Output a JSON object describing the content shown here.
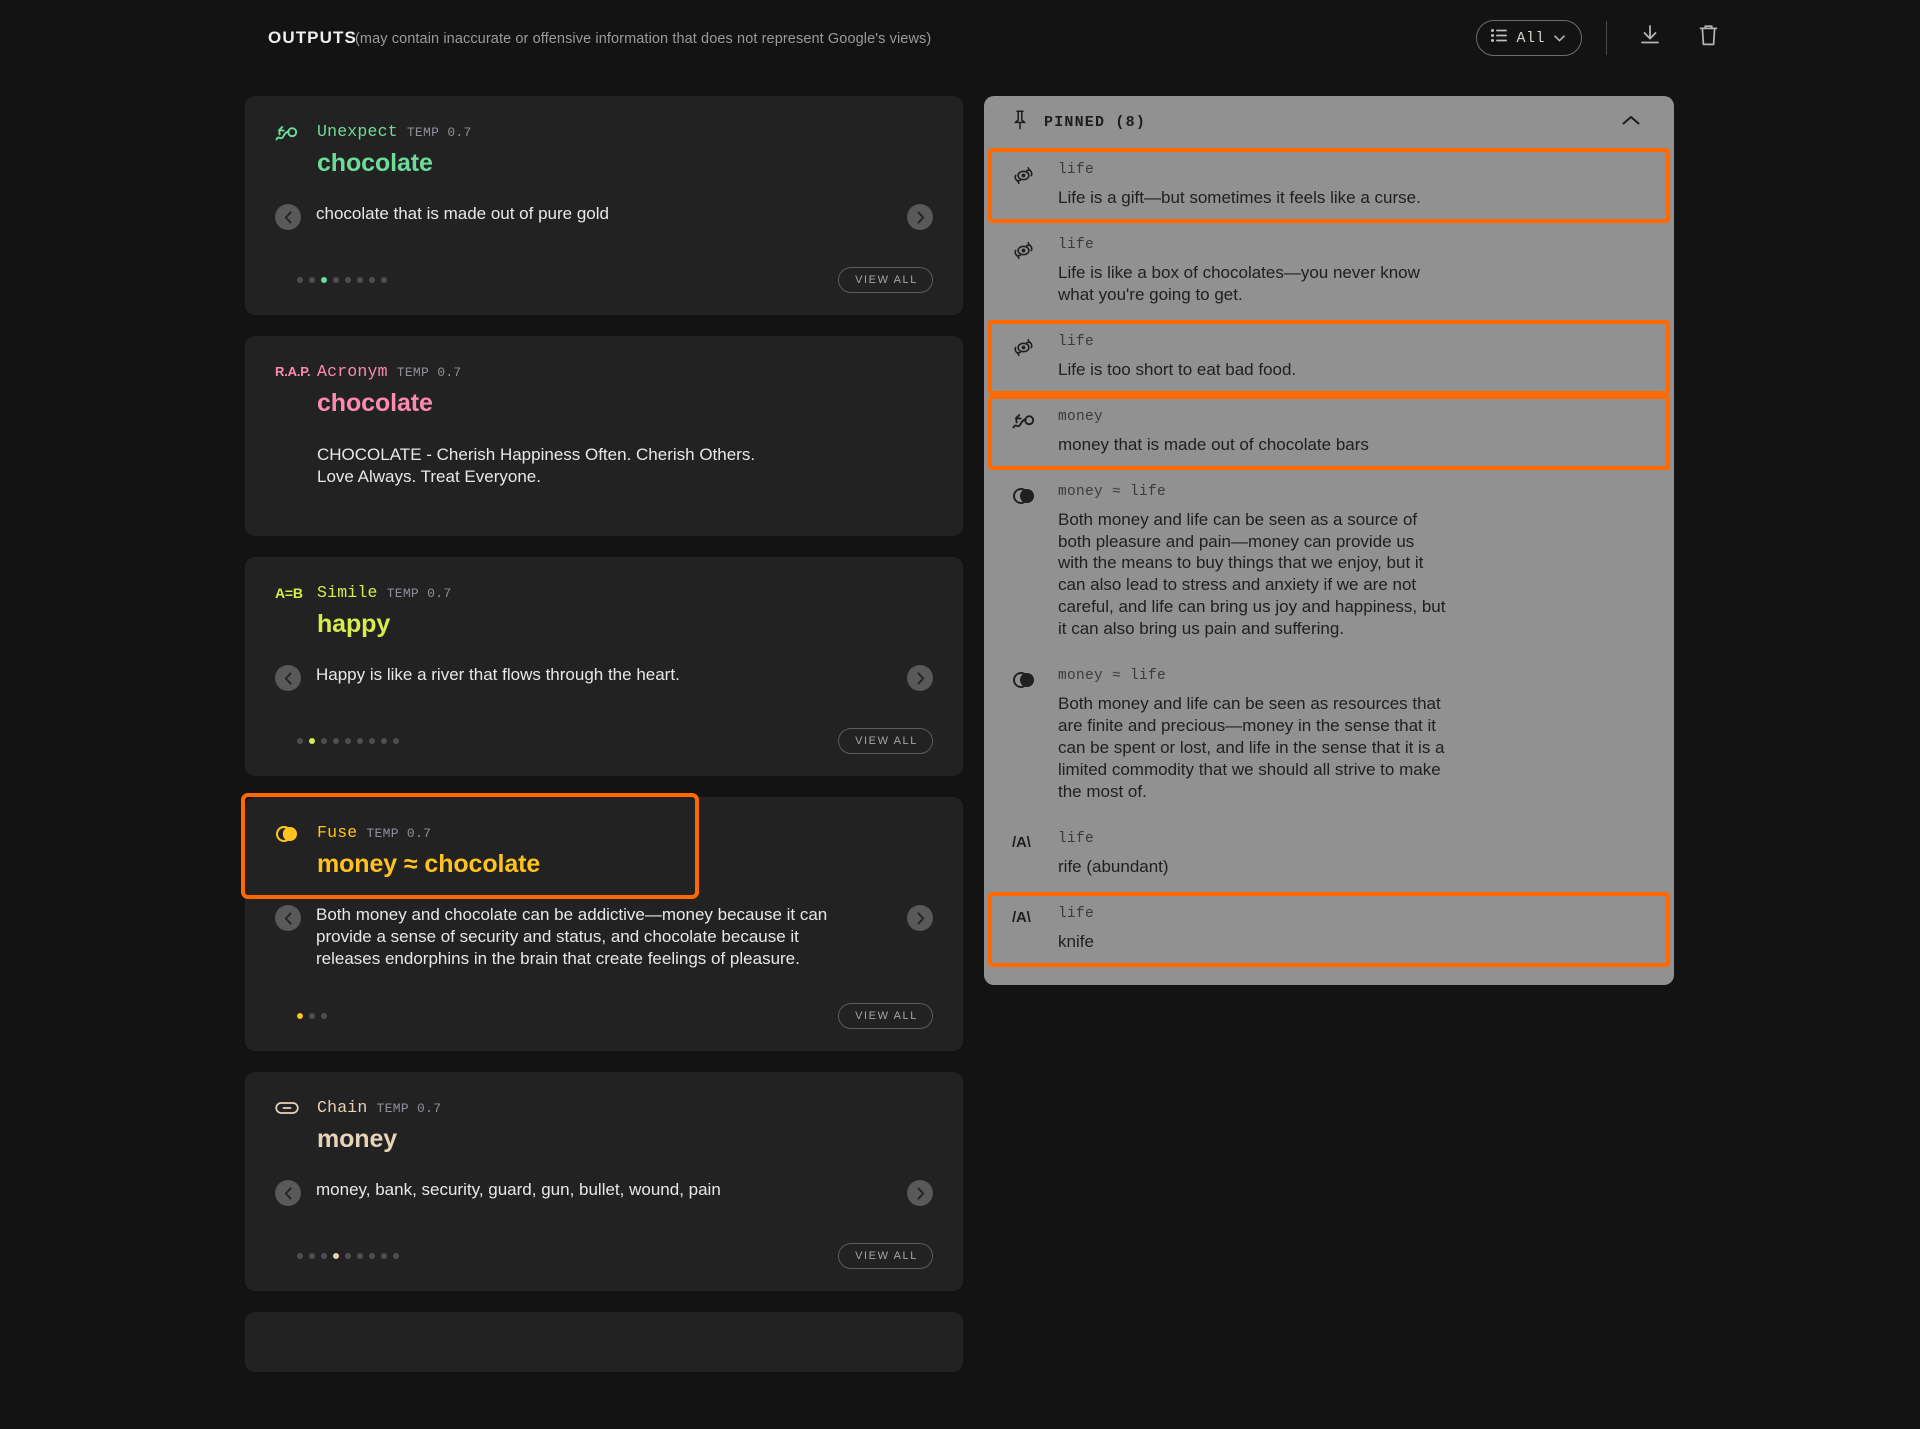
{
  "header": {
    "title": "OUTPUTS",
    "disclaimer": "(may contain inaccurate or offensive information that does not represent Google's views)",
    "filter_label": "All",
    "filter_icon": "list-icon",
    "chevron_icon": "chevron-down-icon",
    "download_icon": "download-icon",
    "delete_icon": "trash-icon"
  },
  "colors": {
    "page_bg": "#131313",
    "card_bg": "#222222",
    "panel_bg": "#919191",
    "highlight": "#ff6a00",
    "unexpect": "#6ddc9a",
    "acronym": "#ff8ab0",
    "simile": "#d6ed4b",
    "fuse": "#ffc21f",
    "chain": "#e7d3b8"
  },
  "cards": [
    {
      "type": "Unexpect",
      "icon": "squiggle-arrow-icon",
      "temp": "TEMP 0.7",
      "term": "chocolate",
      "color": "#6ddc9a",
      "body": "chocolate that is made out of pure gold",
      "layout": "carousel",
      "dots_total": 8,
      "dots_active": 3,
      "view_all": "VIEW ALL",
      "highlighted": false
    },
    {
      "type": "Acronym",
      "icon": "rap-text-icon",
      "icon_text": "R.A.P.",
      "temp": "TEMP 0.7",
      "term": "chocolate",
      "color": "#ff8ab0",
      "body": "CHOCOLATE - Cherish Happiness Often. Cherish Others. Love Always. Treat Everyone.",
      "layout": "plain",
      "highlighted": false
    },
    {
      "type": "Simile",
      "icon": "a-equals-b-icon",
      "icon_text": "A=B",
      "temp": "TEMP 0.7",
      "term": "happy",
      "color": "#d6ed4b",
      "body": "Happy is like a river that flows through the heart.",
      "layout": "carousel",
      "dots_total": 9,
      "dots_active": 2,
      "view_all": "VIEW ALL",
      "highlighted": false
    },
    {
      "type": "Fuse",
      "icon": "venn-circles-icon",
      "temp": "TEMP 0.7",
      "term": "money ≈ chocolate",
      "color": "#ffc21f",
      "body": "Both money and chocolate can be addictive—money because it can provide a sense of security and status, and chocolate because it releases endorphins in the brain that create feelings of pleasure.",
      "layout": "carousel",
      "dots_total": 3,
      "dots_active": 1,
      "view_all": "VIEW ALL",
      "highlighted": true
    },
    {
      "type": "Chain",
      "icon": "link-icon",
      "temp": "TEMP 0.7",
      "term": "money",
      "color": "#e7d3b8",
      "body": "money, bank, security, guard, gun, bullet, wound, pain",
      "layout": "carousel",
      "dots_total": 9,
      "dots_active": 4,
      "view_all": "VIEW ALL",
      "highlighted": false
    }
  ],
  "pinned": {
    "title": "PINNED (8)",
    "pin_icon": "pin-icon",
    "collapse_icon": "chevron-up-icon",
    "items": [
      {
        "icon": "eye-swoosh-icon",
        "key": "life",
        "text": "Life is a gift—but sometimes it feels like a curse.",
        "highlighted": true
      },
      {
        "icon": "eye-swoosh-icon",
        "key": "life",
        "text": "Life is like a box of chocolates—you never know what you're going to get.",
        "highlighted": false
      },
      {
        "icon": "eye-swoosh-icon",
        "key": "life",
        "text": "Life is too short to eat bad food.",
        "highlighted": true
      },
      {
        "icon": "squiggle-arrow-icon",
        "key": "money",
        "text": "money that is made out of chocolate bars",
        "highlighted": true
      },
      {
        "icon": "venn-circles-icon",
        "key": "money ≈ life",
        "text": "Both money and life can be seen as a source of both pleasure and pain—money can provide us with the means to buy things that we enjoy, but it can also lead to stress and anxiety if we are not careful, and life can bring us joy and happiness, but it can also bring us pain and suffering.",
        "highlighted": false
      },
      {
        "icon": "venn-circles-icon",
        "key": "money ≈ life",
        "text": "Both money and life can be seen as resources that are finite and precious—money in the sense that it can be spent or lost, and life in the sense that it is a limited commodity that we should all strive to make the most of.",
        "highlighted": false
      },
      {
        "icon": "alliteration-icon",
        "icon_text": "/A\\",
        "key": "life",
        "text": "rife (abundant)",
        "highlighted": false
      },
      {
        "icon": "alliteration-icon",
        "icon_text": "/A\\",
        "key": "life",
        "text": "knife",
        "highlighted": true
      }
    ]
  }
}
